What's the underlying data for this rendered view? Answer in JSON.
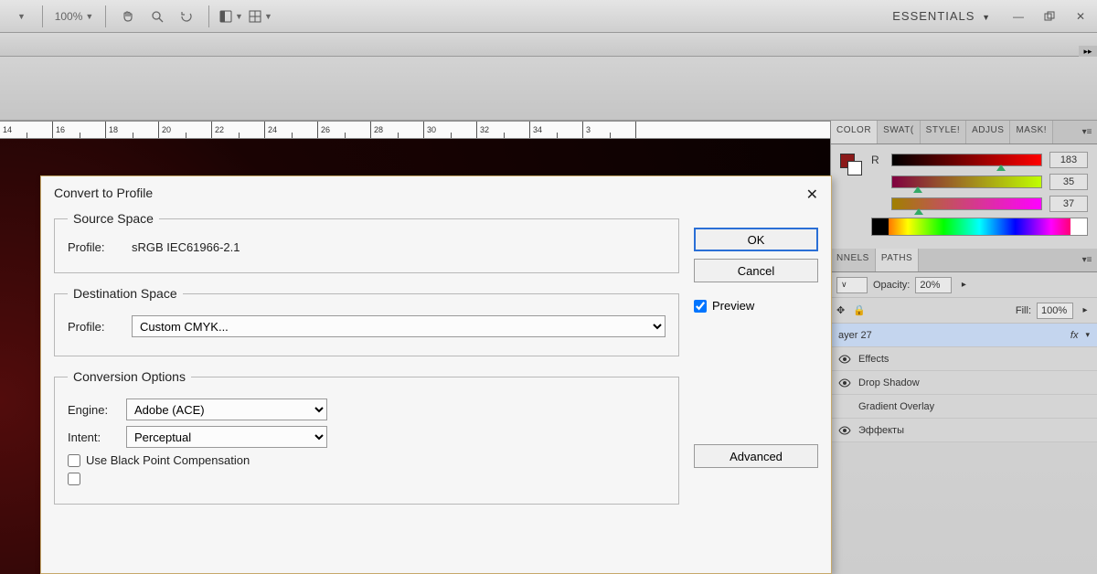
{
  "toolbar": {
    "zoom": "100%"
  },
  "workspace": {
    "label": "ESSENTIALS"
  },
  "ruler": [
    "14",
    "16",
    "18",
    "20",
    "22",
    "24",
    "26",
    "28",
    "30",
    "32",
    "34",
    "3"
  ],
  "panels": {
    "color_tabs": {
      "color": "COLOR",
      "swatches": "SWAT(",
      "styles": "STYLE!",
      "adjust": "ADJUS",
      "masks": "MASK!"
    },
    "color": {
      "r_label": "R",
      "r_val": "183",
      "g_val": "35",
      "b_val": "37"
    },
    "layers_tabs": {
      "channels": "NNELS",
      "paths": "PATHS"
    },
    "layers": {
      "opacity_label": "Opacity:",
      "opacity_val": "20%",
      "fill_label": "Fill:",
      "fill_val": "100%",
      "layer_name": "ayer 27",
      "fx": "fx",
      "effects": "Effects",
      "dropshadow": "Drop Shadow",
      "gradov": "Gradient Overlay",
      "efekty": "Эффекты"
    }
  },
  "dialog": {
    "title": "Convert to Profile",
    "source_legend": "Source Space",
    "source_profile_label": "Profile:",
    "source_profile_value": "sRGB IEC61966-2.1",
    "dest_legend": "Destination Space",
    "dest_profile_label": "Profile:",
    "dest_profile_value": "Custom CMYK...",
    "conv_legend": "Conversion Options",
    "engine_label": "Engine:",
    "engine_value": "Adobe (ACE)",
    "intent_label": "Intent:",
    "intent_value": "Perceptual",
    "bpc": "Use Black Point Compensation",
    "ok": "OK",
    "cancel": "Cancel",
    "preview": "Preview",
    "advanced": "Advanced"
  }
}
